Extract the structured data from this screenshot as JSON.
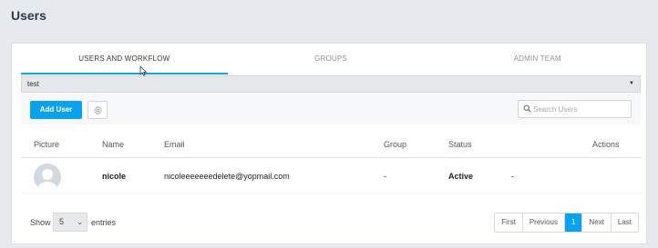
{
  "page": {
    "title": "Users"
  },
  "tabs": [
    {
      "label": "USERS AND WORKFLOW",
      "active": true
    },
    {
      "label": "GROUPS",
      "active": false
    },
    {
      "label": "ADMIN TEAM",
      "active": false
    }
  ],
  "filter_select": {
    "value": "test"
  },
  "toolbar": {
    "add_user_label": "Add User",
    "search_placeholder": "Search Users"
  },
  "table": {
    "columns": [
      "Picture",
      "Name",
      "Email",
      "Group",
      "Status",
      "Actions"
    ],
    "rows": [
      {
        "name": "nicole",
        "email": "nicoleeeeeeedelete@yopmail.com",
        "group": "-",
        "status": "Active",
        "actions": "-"
      }
    ]
  },
  "footer": {
    "show_label": "Show",
    "page_length": "5",
    "entries_label": "entries",
    "pagination": [
      "First",
      "Previous",
      "1",
      "Next",
      "Last"
    ],
    "current_page": "1"
  },
  "colors": {
    "accent": "#0aa2ee",
    "background": "#e6e9ed"
  }
}
